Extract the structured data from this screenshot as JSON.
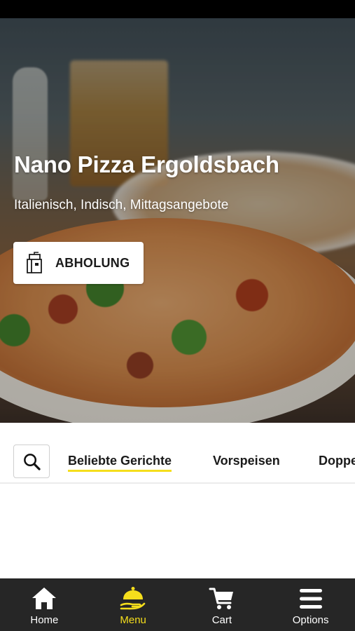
{
  "restaurant": {
    "name": "Nano Pizza Ergoldsbach",
    "cuisines": "Italienisch, Indisch, Mittagsangebote"
  },
  "order_mode": {
    "label": "ABHOLUNG",
    "icon": "takeaway-bag-icon"
  },
  "categories": {
    "search_icon": "search-icon",
    "tabs": [
      {
        "label": "Beliebte Gerichte",
        "active": true
      },
      {
        "label": "Vorspeisen",
        "active": false
      },
      {
        "label": "Doppe",
        "active": false
      }
    ]
  },
  "bottom_nav": {
    "items": [
      {
        "label": "Home",
        "icon": "home-icon",
        "active": false
      },
      {
        "label": "Menu",
        "icon": "serving-cloche-icon",
        "active": true
      },
      {
        "label": "Cart",
        "icon": "cart-icon",
        "active": false
      },
      {
        "label": "Options",
        "icon": "menu-bars-icon",
        "active": false
      }
    ]
  },
  "colors": {
    "accent": "#f5de1c",
    "nav_background": "#262626",
    "status_bar": "#000000"
  }
}
